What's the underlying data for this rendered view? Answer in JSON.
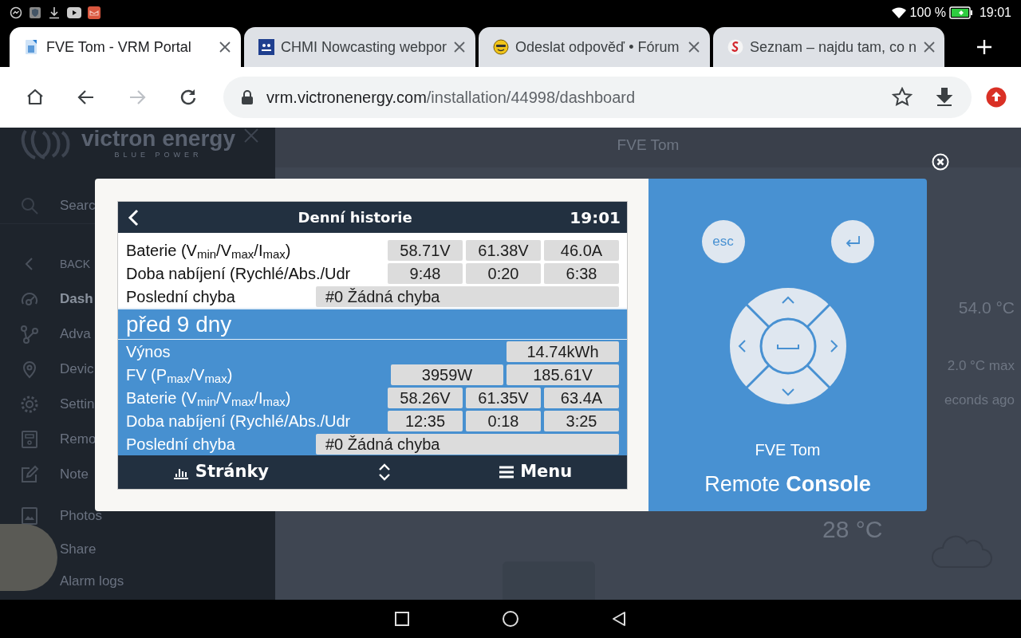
{
  "status_bar": {
    "battery": "100 %",
    "time": "19:01"
  },
  "browser": {
    "tabs": [
      {
        "title": "FVE Tom - VRM Portal",
        "selected": true
      },
      {
        "title": "CHMI Nowcasting webpor",
        "selected": false
      },
      {
        "title": "Odeslat odpověď • Fórum",
        "selected": false
      },
      {
        "title": "Seznam – najdu tam, co n",
        "selected": false
      }
    ],
    "nav_buttons": [
      {
        "kind": "home",
        "disabled": false
      },
      {
        "kind": "back",
        "disabled": false
      },
      {
        "kind": "forward",
        "disabled": true
      },
      {
        "kind": "reload",
        "disabled": false
      }
    ],
    "address": {
      "host": "vrm.victronenergy.com",
      "path": "/installation/44998/dashboard"
    }
  },
  "sidebar": {
    "logo": {
      "name": "victron energy",
      "tagline": "BLUE POWER"
    },
    "search": {
      "placeholder": "Searc"
    },
    "items": [
      {
        "label": "BACK",
        "selected": false
      },
      {
        "label": "Dash",
        "selected": true
      },
      {
        "label": "Adva",
        "selected": false
      },
      {
        "label": "Devic",
        "selected": false
      },
      {
        "label": "Settin",
        "selected": false
      },
      {
        "label": "Remo",
        "selected": false
      },
      {
        "label": "Note",
        "selected": false
      },
      {
        "label": "Photos",
        "selected": false
      },
      {
        "label": "Share",
        "selected": false
      },
      {
        "label": "Alarm logs",
        "selected": false
      }
    ]
  },
  "dashboard": {
    "title": "FVE Tom",
    "readings": [
      "54.0 °C",
      "2.0 °C max",
      "econds ago"
    ],
    "temperature": "28 °C"
  },
  "remote_console": {
    "screen": {
      "title": "Denní historie",
      "time": "19:01",
      "sections": [
        {
          "selected": false,
          "rows": [
            {
              "label": "Baterie (V$_{min}$/V$_{max}$/I$_{max}$)",
              "kind": "values",
              "cells": [
                "58.71V",
                "61.38V",
                "46.0A"
              ]
            },
            {
              "label": "Doba nabíjení (Rychlé/Abs./Udr",
              "kind": "values",
              "cells": [
                "9:48",
                "0:20",
                "6:38"
              ]
            },
            {
              "label": "Poslední chyba",
              "kind": "text",
              "cells": [
                "#0 Žádná chyba"
              ]
            }
          ]
        },
        {
          "title": "před 9 dny",
          "selected": true,
          "rows": [
            {
              "label": "Výnos",
              "kind": "values",
              "cells": [
                "",
                "14.74kWh"
              ]
            },
            {
              "label": "FV (P$_{max}$/V$_{max}$)",
              "kind": "values",
              "cells": [
                "3959W",
                "185.61V"
              ]
            },
            {
              "label": "Baterie (V$_{min}$/V$_{max}$/I$_{max}$)",
              "kind": "values",
              "cells": [
                "58.26V",
                "61.35V",
                "63.4A"
              ]
            },
            {
              "label": "Doba nabíjení (Rychlé/Abs./Udr",
              "kind": "values",
              "cells": [
                "12:35",
                "0:18",
                "3:25"
              ]
            },
            {
              "label": "Poslední chyba",
              "kind": "text",
              "cells": [
                "#0 Žádná chyba"
              ]
            }
          ]
        }
      ],
      "footer": {
        "pages": "Stránky",
        "menu": "Menu"
      }
    },
    "esc": "esc",
    "site": "FVE Tom",
    "brand": "Remote **Console**"
  }
}
